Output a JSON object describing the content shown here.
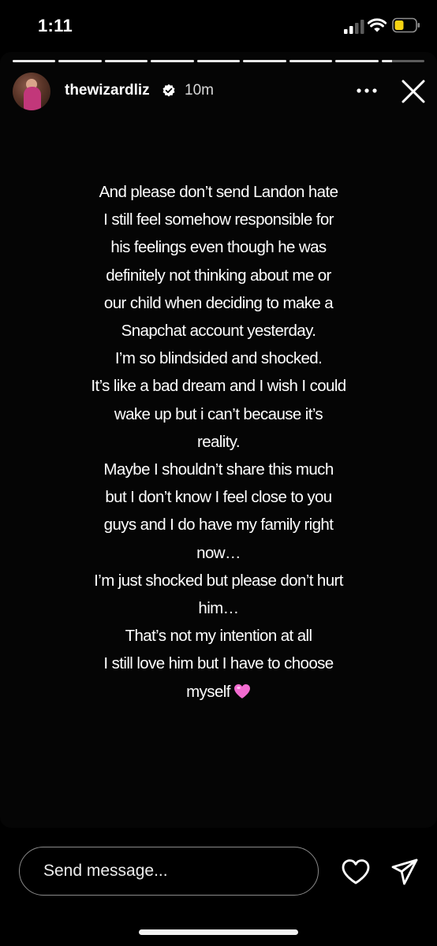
{
  "status_bar": {
    "time": "1:11",
    "icons": [
      "cellular-signal-icon",
      "wifi-icon",
      "battery-icon"
    ],
    "battery_color": "#f5d312"
  },
  "story": {
    "progress": {
      "segment_count": 9,
      "fills": [
        1,
        1,
        1,
        1,
        1,
        1,
        1,
        1,
        0.25
      ]
    },
    "header": {
      "username": "thewizardliz",
      "verified": true,
      "time_ago": "10m",
      "icons": [
        "avatar",
        "verified-badge-icon",
        "more-options-icon",
        "close-icon"
      ]
    },
    "text_lines": [
      "And please don’t send Landon hate",
      "I still feel somehow responsible for",
      "his feelings even though he was",
      "definitely not thinking about me or",
      "our child when deciding to make a",
      "Snapchat account yesterday.",
      "I’m so blindsided and shocked.",
      "It’s like a bad dream and I wish I could",
      "wake up but i can’t because it’s",
      "reality.",
      "Maybe I shouldn’t share this much",
      "but I don’t know I feel close to you",
      "guys and I do have my family right",
      "now…",
      "I’m just shocked but please don’t hurt",
      "him…",
      "That’s not my intention at all",
      "I still love him but I have to choose",
      "myself"
    ],
    "end_emoji": "pink-heart-emoji",
    "emoji_color": "#f26bd0"
  },
  "reply_bar": {
    "input_placeholder": "Send message...",
    "icons": [
      "heart-icon",
      "send-icon"
    ]
  }
}
